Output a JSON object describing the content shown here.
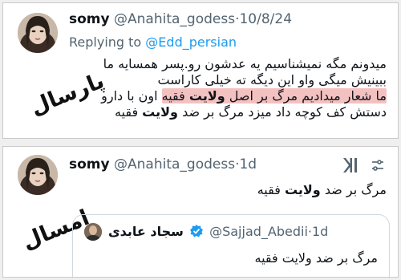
{
  "tweet_top": {
    "author_name": "somy",
    "handle": "@Anahita_godess",
    "separator": "·",
    "date": "10/8/24",
    "replying_prefix": "Replying to",
    "replying_handle": "@Edd_persian",
    "line1": "میدونم مگه نمیشناسیم یه عدشون رو.پسر همسایه ما",
    "line2": "ببینیش میگی واو این دیگه ته خیلی کاراست",
    "line3_pre": "ما شعار میدادیم مرگ بر اصل ",
    "line3_bold": "ولایت",
    "line3_post": " فقیه",
    "line3_tail": " اون با دارو",
    "line4_pre": "دستش کف کوچه داد میزد مرگ بر ضد ",
    "line4_bold": "ولایت",
    "line4_post": " فقیه",
    "side_label": "پارسال"
  },
  "tweet_bottom": {
    "author_name": "somy",
    "handle": "@Anahita_godess",
    "separator": "·",
    "date": "1d",
    "body_pre": "مرگ بر ضد ",
    "body_bold": "ولایت",
    "body_post": " فقیه",
    "side_label": "امسال",
    "quote": {
      "author_name": "سجاد عابدی",
      "handle": "@Sajjad_Abedii",
      "separator": "·",
      "date": "1d",
      "body": "مرگ بر ضد ولایت فقیه"
    }
  },
  "icons": {
    "xai": "x-logo-icon",
    "tune": "tune-icon",
    "verified": "verified-badge-icon",
    "verified_color": "#1d9bf0"
  },
  "colors": {
    "link": "#1d9bf0",
    "muted": "#536471",
    "highlight": "#f4c1c1"
  }
}
